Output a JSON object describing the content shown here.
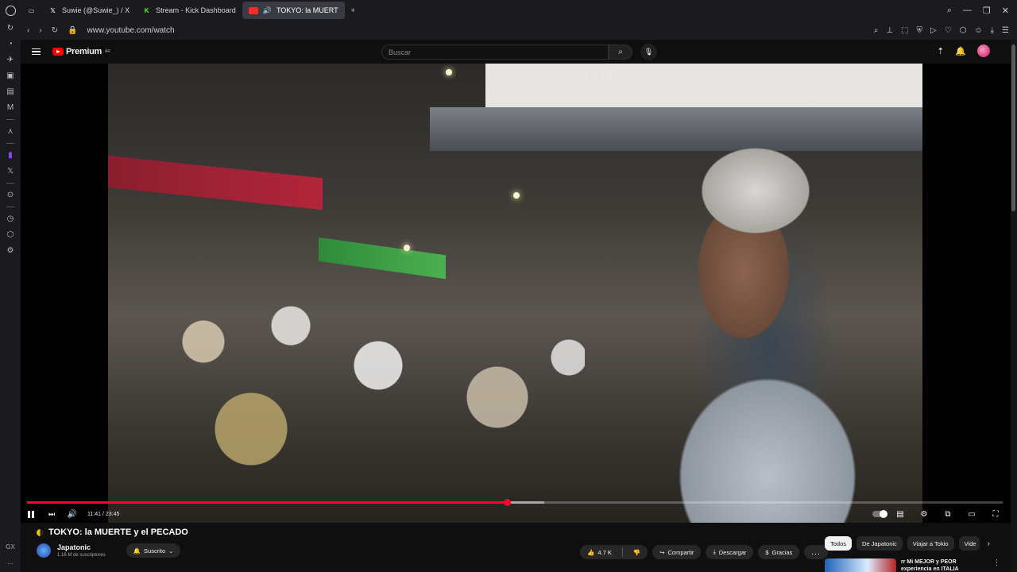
{
  "browser": {
    "tabs": [
      {
        "title": "Suwie (@Suwie_) / X",
        "favicon": "x-logo"
      },
      {
        "title": "Stream - Kick Dashboard",
        "favicon": "kick-logo"
      },
      {
        "title": "TOKYO: la MUERT",
        "favicon": "youtube-logo",
        "active": true
      }
    ],
    "new_tab_label": "+",
    "url": "www.youtube.com/watch",
    "sidebar_bottom_label": "GX"
  },
  "youtube": {
    "logo_text": "Premium",
    "logo_region": "AR",
    "search_placeholder": "Buscar"
  },
  "player": {
    "current_time": "11:41",
    "duration": "23:45",
    "time_display": "11:41 / 23:45",
    "progress_fraction": 0.492,
    "buffered_fraction": 0.53
  },
  "video": {
    "title": "TOKYO: la MUERTE y el PECADO",
    "channel_name": "Japatonic",
    "subscribers": "1.16 M de suscriptores",
    "subscribe_label": "Suscrito",
    "likes": "4.7 K",
    "share_label": "Compartir",
    "download_label": "Descargar",
    "thanks_label": "Gracias",
    "more_label": "..."
  },
  "related": {
    "chips": [
      "Todos",
      "De Japatonic",
      "Viajar a Tokio",
      "Vide"
    ],
    "first_item_text": "rr Mi MEJOR y PEOR experiencia en ITALIA"
  },
  "colors": {
    "accent": "#ff0033",
    "youtube_red": "#ff0000",
    "background": "#0f0f0f"
  }
}
